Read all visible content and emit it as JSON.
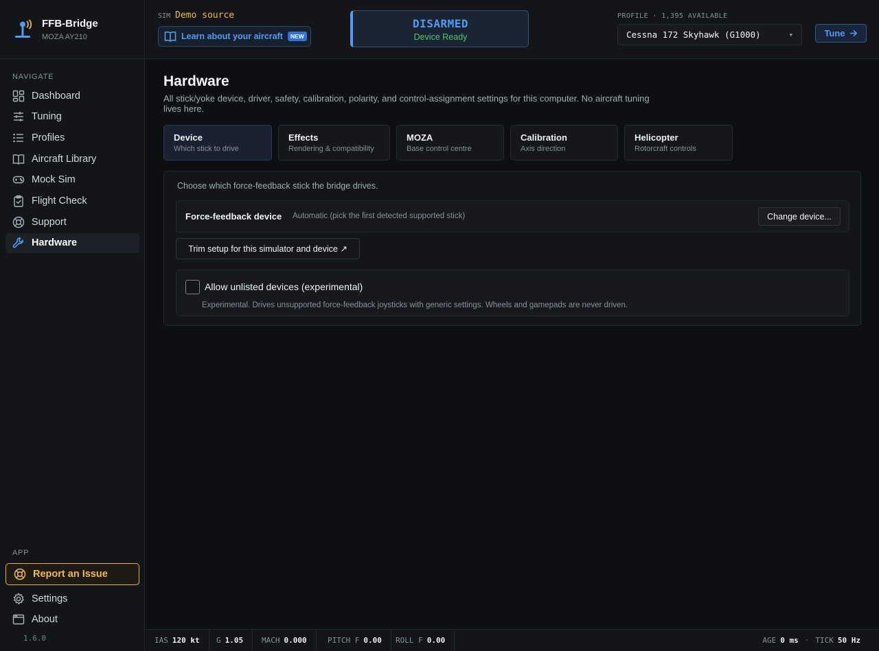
{
  "brand": {
    "title": "FFB-Bridge",
    "subtitle": "MOZA AY210"
  },
  "sidebar": {
    "navigate_label": "NAVIGATE",
    "items": [
      {
        "label": "Dashboard",
        "icon": "dashboard-icon"
      },
      {
        "label": "Tuning",
        "icon": "sliders-icon"
      },
      {
        "label": "Profiles",
        "icon": "list-icon"
      },
      {
        "label": "Aircraft Library",
        "icon": "book-icon"
      },
      {
        "label": "Mock Sim",
        "icon": "gamepad-icon"
      },
      {
        "label": "Flight Check",
        "icon": "clipboard-check-icon"
      },
      {
        "label": "Support",
        "icon": "lifebuoy-icon"
      },
      {
        "label": "Hardware",
        "icon": "wrench-icon",
        "active": true
      }
    ],
    "app_label": "APP",
    "report": "Report an Issue",
    "settings": "Settings",
    "about": "About",
    "version": "1.6.0"
  },
  "topbar": {
    "sim_label": "SIM",
    "sim_value": "Demo source",
    "learn_label": "Learn about your aircraft",
    "new_badge": "NEW",
    "status_main": "DISARMED",
    "status_sub": "Device Ready",
    "profile_label": "PROFILE · 1,395 AVAILABLE",
    "profile_value": "Cessna 172 Skyhawk (G1000)",
    "tune_label": "Tune"
  },
  "main": {
    "title": "Hardware",
    "description": "All stick/yoke device, driver, safety, calibration, polarity, and control-assignment settings for this computer. No aircraft tuning lives here.",
    "tabs": [
      {
        "title": "Device",
        "sub": "Which stick to drive"
      },
      {
        "title": "Effects",
        "sub": "Rendering & compatibility"
      },
      {
        "title": "MOZA",
        "sub": "Base control centre"
      },
      {
        "title": "Calibration",
        "sub": "Axis direction"
      },
      {
        "title": "Helicopter",
        "sub": "Rotorcraft controls"
      }
    ],
    "panel_intro": "Choose which force-feedback stick the bridge drives.",
    "device_label": "Force-feedback device",
    "device_value": "Automatic (pick the first detected supported stick)",
    "change_button": "Change device...",
    "trim_button": "Trim setup for this simulator and device ↗",
    "unlisted_label": "Allow unlisted devices (experimental)",
    "unlisted_desc": "Experimental. Drives unsupported force-feedback joysticks with generic settings. Wheels and gamepads are never driven."
  },
  "statusbar": {
    "telemetry": [
      {
        "key": "IAS",
        "value": "120 kt"
      },
      {
        "key": "G",
        "value": "1.05"
      },
      {
        "key": "MACH",
        "value": "0.000"
      },
      {
        "key": "PITCH F",
        "value": "0.00"
      },
      {
        "key": "ROLL F",
        "value": "0.00"
      }
    ],
    "age_key": "AGE",
    "age_value": "0 ms",
    "tick_key": "TICK",
    "tick_value": "50 Hz"
  },
  "colors": {
    "accent": "#4f9cf5",
    "warning": "#f0b94a",
    "ok": "#4cc870",
    "background": "#0e0f12"
  }
}
